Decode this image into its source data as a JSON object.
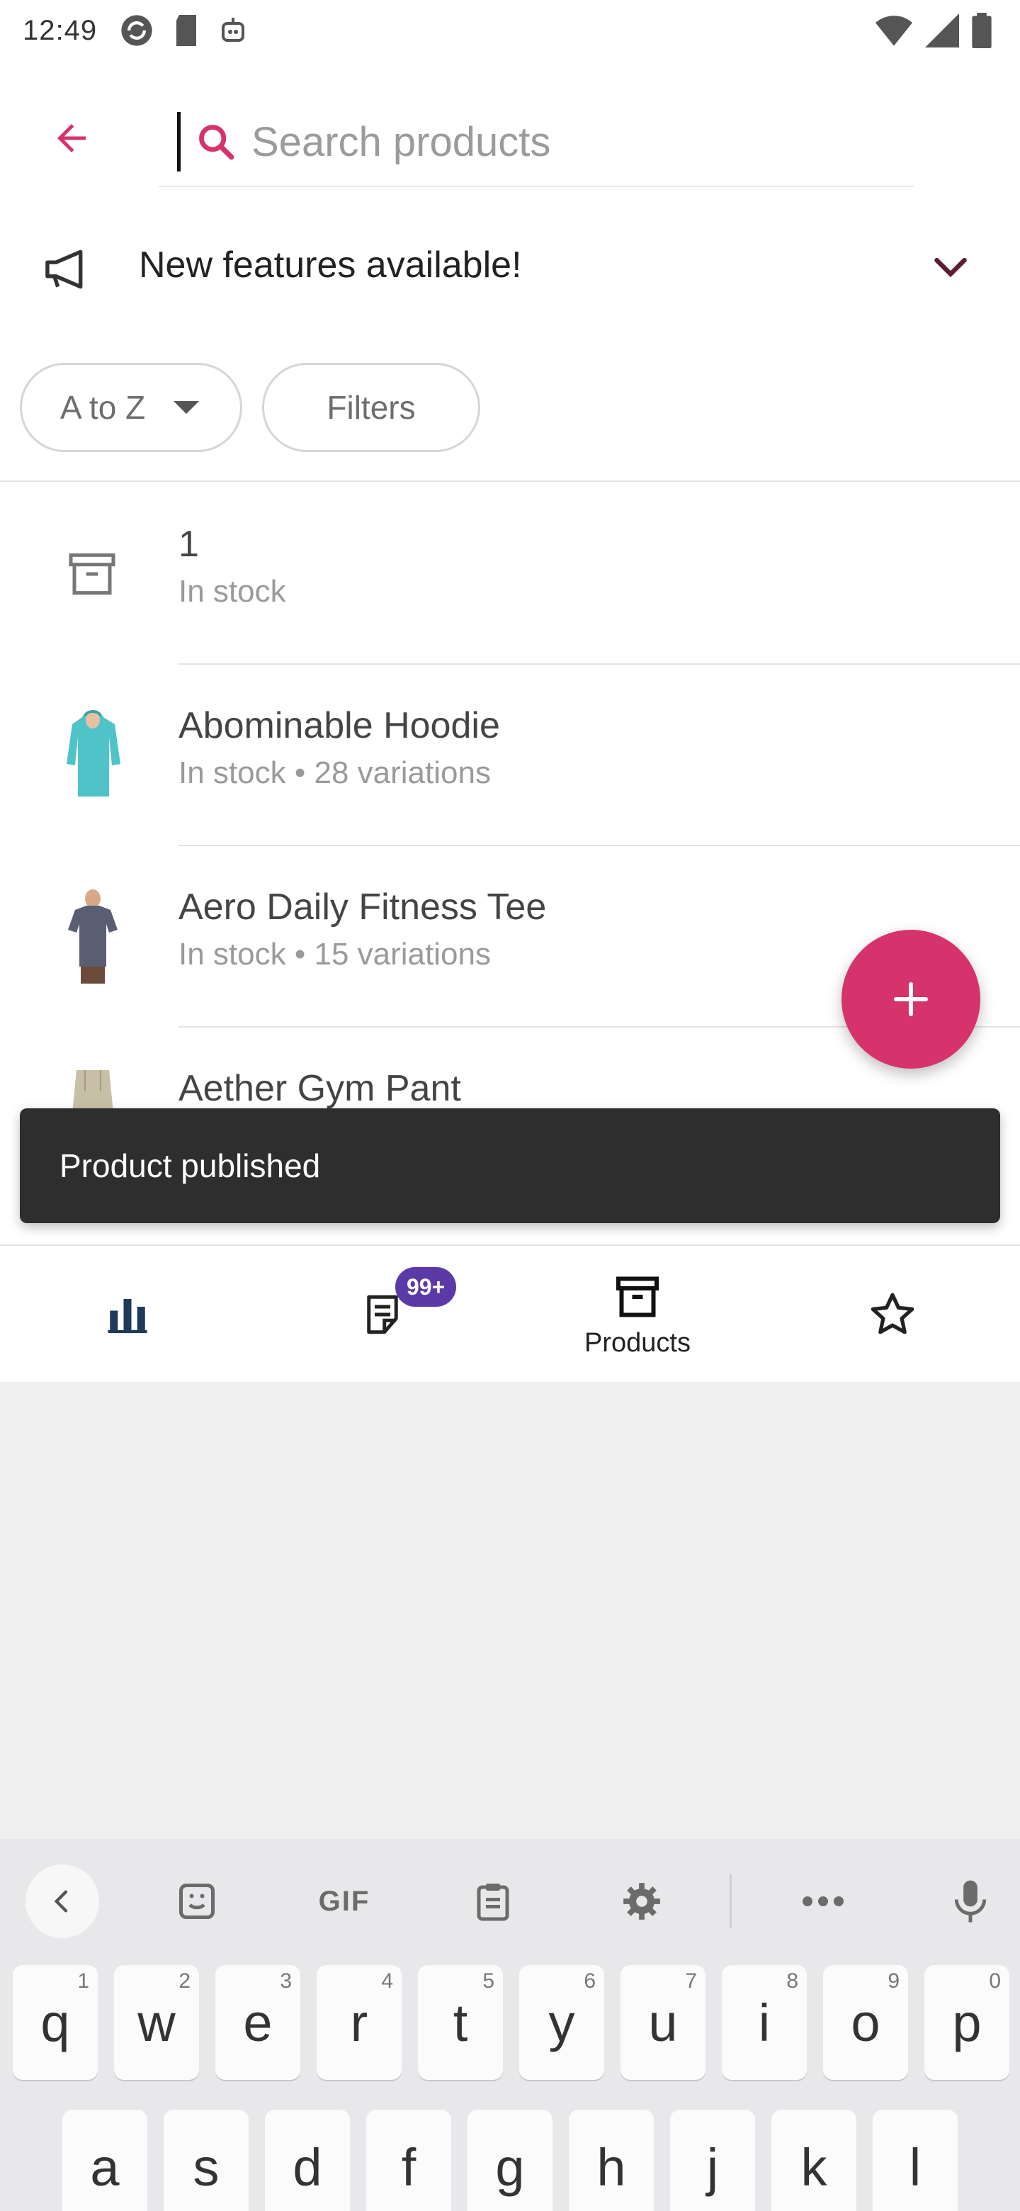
{
  "status_bar": {
    "time": "12:49"
  },
  "header": {
    "search_placeholder": "Search products"
  },
  "announcement": {
    "text": "New features available!"
  },
  "chips": {
    "sort_label": "A to Z",
    "filters_label": "Filters"
  },
  "products": [
    {
      "name": "1",
      "status": "In stock",
      "thumb": "archive-icon"
    },
    {
      "name": "Abominable Hoodie",
      "status": "In stock • 28 variations",
      "thumb": "teal-hoodie"
    },
    {
      "name": "Aero Daily Fitness Tee",
      "status": "In stock • 15 variations",
      "thumb": "gray-tee"
    },
    {
      "name": "Aether Gym Pant",
      "status": "",
      "thumb": "khaki-pant"
    }
  ],
  "snackbar": {
    "text": "Product published"
  },
  "bottom_nav": {
    "items": [
      {
        "icon": "bar-chart-icon",
        "label": ""
      },
      {
        "icon": "orders-icon",
        "label": "",
        "badge": "99+"
      },
      {
        "icon": "archive-icon",
        "label": "Products"
      },
      {
        "icon": "star-icon",
        "label": ""
      }
    ]
  },
  "keyboard": {
    "row1": [
      {
        "key": "q",
        "hint": "1"
      },
      {
        "key": "w",
        "hint": "2"
      },
      {
        "key": "e",
        "hint": "3"
      },
      {
        "key": "r",
        "hint": "4"
      },
      {
        "key": "t",
        "hint": "5"
      },
      {
        "key": "y",
        "hint": "6"
      },
      {
        "key": "u",
        "hint": "7"
      },
      {
        "key": "i",
        "hint": "8"
      },
      {
        "key": "o",
        "hint": "9"
      },
      {
        "key": "p",
        "hint": "0"
      }
    ],
    "row2": [
      "a",
      "s",
      "d",
      "f",
      "g",
      "h",
      "j",
      "k",
      "l"
    ],
    "gif_label": "GIF"
  },
  "colors": {
    "accent": "#d6336c",
    "badge": "#5b3aa8",
    "snackbar_bg": "#2e2e2e"
  }
}
